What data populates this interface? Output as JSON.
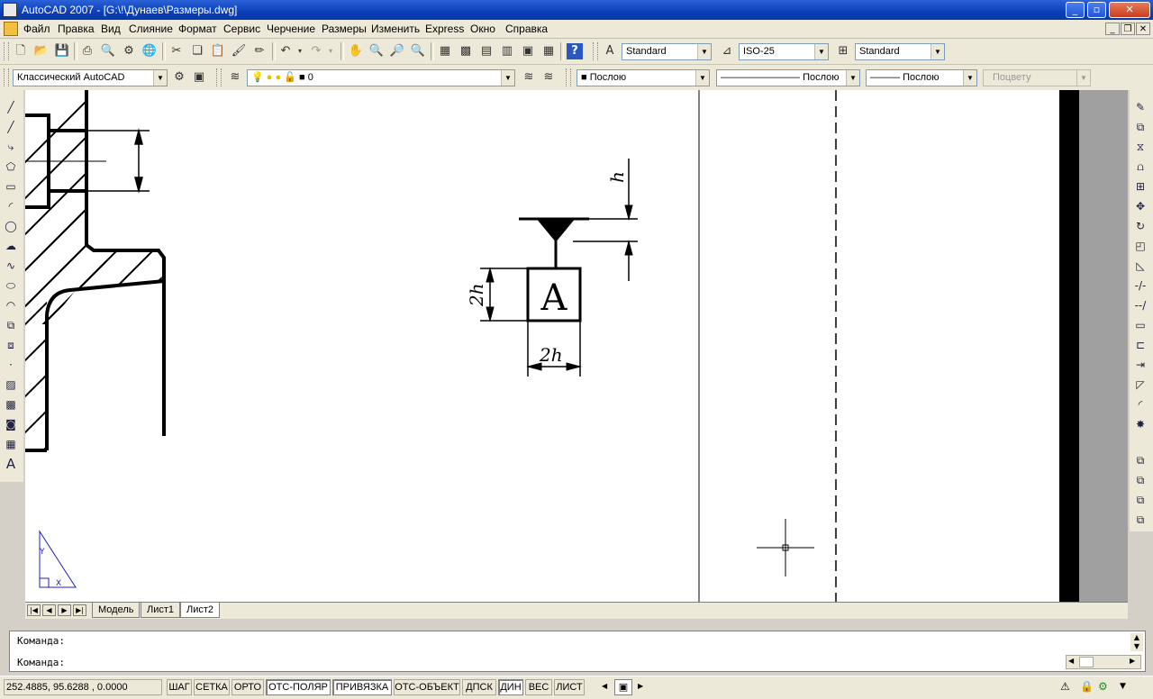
{
  "window": {
    "title": "AutoCAD 2007 - [G:\\!\\Дунаев\\Размеры.dwg]",
    "controls": {
      "minimize": "_",
      "maximize": "▫",
      "close": "✕"
    },
    "mdi_controls": {
      "minimize": "_",
      "restore": "❐",
      "close": "✕"
    }
  },
  "menu": [
    "Файл",
    "Правка",
    "Вид",
    "Слияние",
    "Формат",
    "Сервис",
    "Черчение",
    "Размеры",
    "Изменить",
    "Express",
    "Окно",
    "Справка"
  ],
  "toolbar_styles": {
    "text_style": "Standard",
    "dim_style": "ISO-25",
    "table_style": "Standard"
  },
  "toolbar_layers": {
    "workspace": "Классический AutoCAD",
    "layer": "0",
    "color": "Послою",
    "linetype": "Послою",
    "lineweight": "Послою",
    "plotstyle": "Поцвету"
  },
  "drawing": {
    "labels": {
      "h": "h",
      "two_h_vertical": "2h",
      "two_h_horizontal": "2h",
      "datum_letter": "A"
    },
    "ucs": {
      "x": "X",
      "y": "Y"
    }
  },
  "layout_tabs": {
    "nav": {
      "first": "|◀",
      "prev": "◀",
      "next": "▶",
      "last": "▶|"
    },
    "tabs": [
      "Модель",
      "Лист1",
      "Лист2"
    ],
    "active": "Лист2"
  },
  "command": {
    "history_line": "Команда:",
    "prompt_line": "Команда:"
  },
  "status": {
    "coordinates": "252.4885, 95.6288 , 0.0000",
    "buttons": [
      {
        "label": "ШАГ",
        "on": false
      },
      {
        "label": "СЕТКА",
        "on": false
      },
      {
        "label": "ОРТО",
        "on": false
      },
      {
        "label": "ОТС-ПОЛЯР",
        "on": true
      },
      {
        "label": "ПРИВЯЗКА",
        "on": true
      },
      {
        "label": "ОТС-ОБЪЕКТ",
        "on": false
      },
      {
        "label": "ДПСК",
        "on": false
      },
      {
        "label": "ДИН",
        "on": true
      },
      {
        "label": "ВЕС",
        "on": false
      },
      {
        "label": "ЛИСТ",
        "on": false
      }
    ]
  }
}
